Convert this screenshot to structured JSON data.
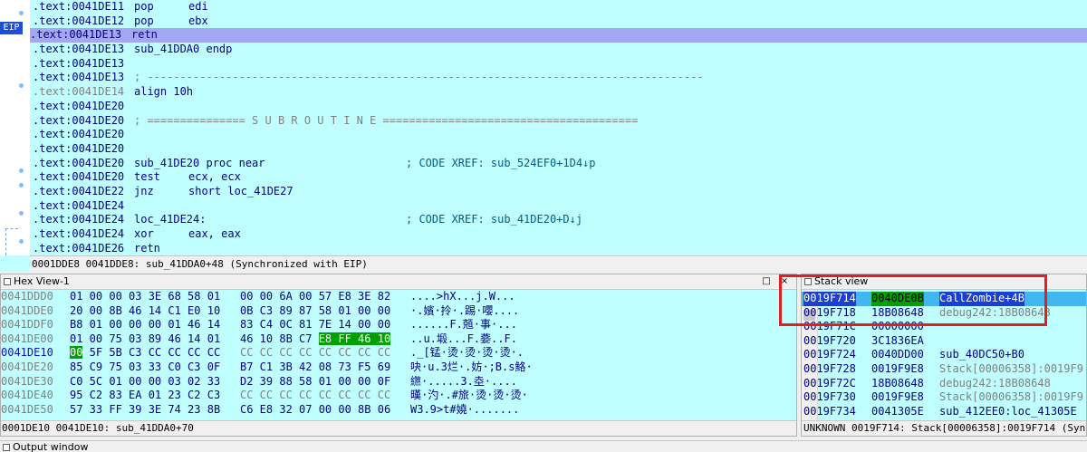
{
  "disasm": {
    "eip_label": "EIP",
    "status": "0001DDE8 0041DDE8: sub_41DDA0+48 (Synchronized with EIP)",
    "lines": [
      {
        "addr": ".text:0041DE11",
        "mn": "pop",
        "op": "edi",
        "cm": ""
      },
      {
        "addr": ".text:0041DE12",
        "mn": "pop",
        "op": "ebx",
        "cm": ""
      },
      {
        "addr": ".text:0041DE13",
        "mn": "retn",
        "op": "",
        "cm": ""
      },
      {
        "addr": ".text:0041DE13",
        "mn": "sub_41DDA0 endp",
        "op": "",
        "cm": ""
      },
      {
        "addr": ".text:0041DE13",
        "mn": "",
        "op": "",
        "cm": ""
      },
      {
        "addr": ".text:0041DE13",
        "mn": "; -------------------------------------------------------------------------------------",
        "op": "",
        "cm": ""
      },
      {
        "addr": ".text:0041DE14",
        "mn": "align 10h",
        "op": "",
        "cm": ""
      },
      {
        "addr": ".text:0041DE20",
        "mn": "",
        "op": "",
        "cm": ""
      },
      {
        "addr": ".text:0041DE20",
        "mn": "; =============== S U B R O U T I N E =======================================",
        "op": "",
        "cm": ""
      },
      {
        "addr": ".text:0041DE20",
        "mn": "",
        "op": "",
        "cm": ""
      },
      {
        "addr": ".text:0041DE20",
        "mn": "",
        "op": "",
        "cm": ""
      },
      {
        "addr": ".text:0041DE20",
        "mn": "sub_41DE20 proc near",
        "op": "",
        "cm": "; CODE XREF: sub_524EF0+1D4↓p"
      },
      {
        "addr": ".text:0041DE20",
        "mn": "test",
        "op": "ecx, ecx",
        "cm": ""
      },
      {
        "addr": ".text:0041DE22",
        "mn": "jnz",
        "op": "short loc_41DE27",
        "cm": ""
      },
      {
        "addr": ".text:0041DE24",
        "mn": "",
        "op": "",
        "cm": ""
      },
      {
        "addr": ".text:0041DE24",
        "mn": "loc_41DE24:",
        "op": "",
        "cm": "; CODE XREF: sub_41DE20+D↓j"
      },
      {
        "addr": ".text:0041DE24",
        "mn": "xor",
        "op": "eax, eax",
        "cm": ""
      },
      {
        "addr": ".text:0041DE26",
        "mn": "retn",
        "op": "",
        "cm": ""
      }
    ]
  },
  "hex": {
    "title": "Hex View-1",
    "close_glyph": "×",
    "restore_glyph": "□",
    "status": "0001DE10 0041DE10: sub_41DDA0+70",
    "rows": [
      {
        "addr": "0041DDD0",
        "b1": "01 00 00 03 3E 68 58 01",
        "b2": "00 00 6A 00 57 E8 3E 82",
        "asc": "....>hX...j.W..."
      },
      {
        "addr": "0041DDE0",
        "b1": "20 00 8B 46 14 C1 E0 10",
        "b2": "0B C3 89 87 58 01 00 00",
        "asc": "·.嬪·拎·.踢·嚶...."
      },
      {
        "addr": "0041DDF0",
        "b1": "B8 01 00 00 00 01 46 14",
        "b2": "83 C4 0C 81 7E 14 00 00",
        "asc": "......F.兡·事·..."
      },
      {
        "addr": "0041DE00",
        "b1": "01 00 75 03 89 46 14 01",
        "b2": "46 10 8B C7 E8 FF 46 10",
        "asc": "..u.塅...F.嬊..F."
      },
      {
        "addr": "0041DE10",
        "b1": "00 5F 5B C3 CC CC CC CC",
        "b2": "CC CC CC CC CC CC CC CC",
        "asc": "._[锰·烫·烫·烫·烫·."
      },
      {
        "addr": "0041DE20",
        "b1": "85 C9 75 03 33 C0 C3 0F",
        "b2": "B7 C1 3B 42 08 73 F5 69",
        "asc": "吷·u.3烂·.妨·;B.s鮥·"
      },
      {
        "addr": "0041DE30",
        "b1": "C0 5C 01 00 00 03 02 33",
        "b2": "D2 39 88 58 01 00 00 0F",
        "asc": "繺·.....3.坴·...."
      },
      {
        "addr": "0041DE40",
        "b1": "95 C2 83 EA 01 23 C2 C3",
        "b2": "CC CC CC CC CC CC CC CC",
        "asc": "暵·汋·.#旅·烫·烫·烫·"
      },
      {
        "addr": "0041DE50",
        "b1": "57 33 FF 39 3E 74 23 8B",
        "b2": "C6 E8 32 07 00 00 8B 06",
        "asc": "W3.9>t#嬈·......."
      }
    ]
  },
  "stack": {
    "title": "Stack view",
    "up_glyph": "▲",
    "status": "UNKNOWN 0019F714: Stack[00006358]:0019F714 (Synchrono",
    "rows": [
      {
        "addr": "0019F714",
        "val": "0040DE0B",
        "desc": "CallZombie+4B"
      },
      {
        "addr": "0019F718",
        "val": "18B08648",
        "desc": "debug242:18B08648"
      },
      {
        "addr": "0019F71C",
        "val": "00000000",
        "desc": ""
      },
      {
        "addr": "0019F720",
        "val": "3C1836EA",
        "desc": ""
      },
      {
        "addr": "0019F724",
        "val": "0040DD00",
        "desc": "sub_40DC50+B0"
      },
      {
        "addr": "0019F728",
        "val": "0019F9E8",
        "desc": "Stack[00006358]:0019F9"
      },
      {
        "addr": "0019F72C",
        "val": "18B08648",
        "desc": "debug242:18B08648"
      },
      {
        "addr": "0019F730",
        "val": "0019F9E8",
        "desc": "Stack[00006358]:0019F9"
      },
      {
        "addr": "0019F734",
        "val": "0041305E",
        "desc": "sub_412EE0:loc_41305E"
      }
    ]
  },
  "output": {
    "title": "Output window"
  }
}
